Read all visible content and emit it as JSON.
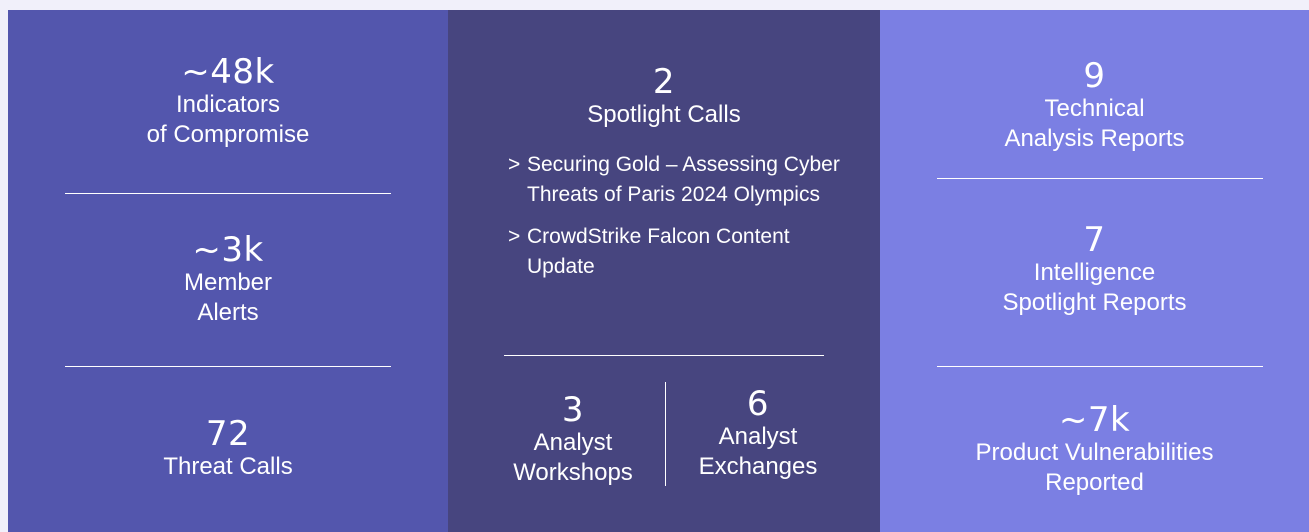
{
  "left": {
    "stats": [
      {
        "value": "~48k",
        "label_lines": [
          "Indicators",
          "of Compromise"
        ]
      },
      {
        "value": "~3k",
        "label_lines": [
          "Member",
          "Alerts"
        ]
      },
      {
        "value": "72",
        "label_lines": [
          "Threat Calls"
        ]
      }
    ]
  },
  "middle": {
    "top": {
      "value": "2",
      "label": "Spotlight Calls"
    },
    "bullet_marker": ">",
    "bullets": [
      "Securing Gold – Assessing Cyber Threats of Paris 2024 Olympics",
      "CrowdStrike Falcon Content Update"
    ],
    "bottom": [
      {
        "value": "3",
        "label_lines": [
          "Analyst",
          "Workshops"
        ]
      },
      {
        "value": "6",
        "label_lines": [
          "Analyst",
          "Exchanges"
        ]
      }
    ]
  },
  "right": {
    "stats": [
      {
        "value": "9",
        "label_lines": [
          "Technical",
          "Analysis Reports"
        ]
      },
      {
        "value": "7",
        "label_lines": [
          "Intelligence",
          "Spotlight Reports"
        ]
      },
      {
        "value": "~7k",
        "label_lines": [
          "Product Vulnerabilities",
          "Reported"
        ]
      }
    ]
  },
  "colors": {
    "background": "#f1f0fa",
    "left_panel": "#5356ad",
    "middle_panel": "#47457f",
    "right_panel": "#7b7fe3",
    "text": "#ffffff"
  }
}
